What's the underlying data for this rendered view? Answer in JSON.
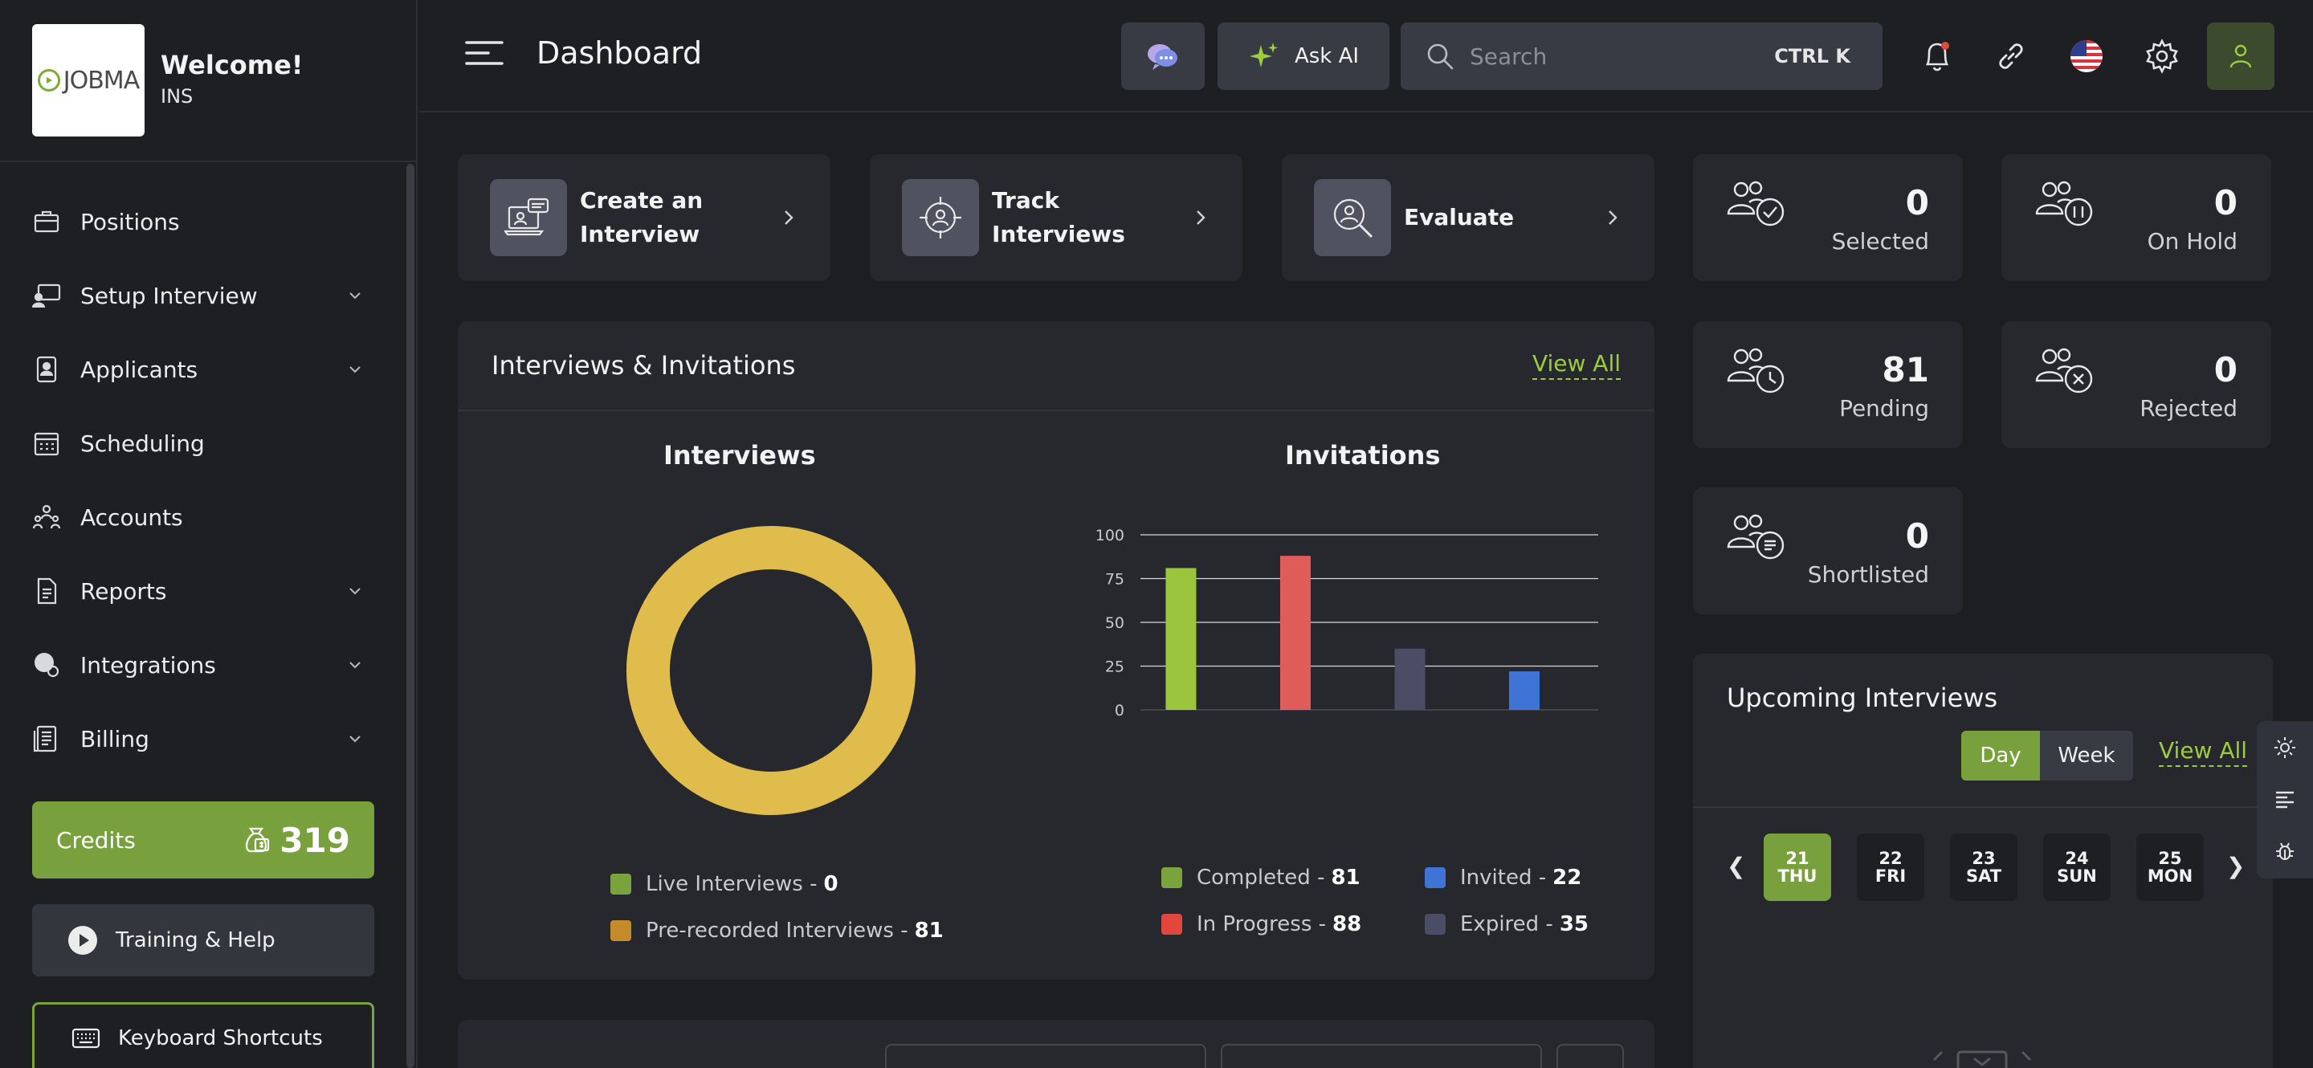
{
  "brand": {
    "logo_text": "JOBMA",
    "welcome": "Welcome!",
    "org": "INS"
  },
  "sidebar": {
    "items": [
      {
        "label": "Positions",
        "icon": "briefcase-icon",
        "expandable": false
      },
      {
        "label": "Setup Interview",
        "icon": "screen-user-icon",
        "expandable": true
      },
      {
        "label": "Applicants",
        "icon": "id-card-icon",
        "expandable": true
      },
      {
        "label": "Scheduling",
        "icon": "calendar-icon",
        "expandable": false
      },
      {
        "label": "Accounts",
        "icon": "team-icon",
        "expandable": false
      },
      {
        "label": "Reports",
        "icon": "document-icon",
        "expandable": true
      },
      {
        "label": "Integrations",
        "icon": "puzzle-icon",
        "expandable": true
      },
      {
        "label": "Billing",
        "icon": "receipt-icon",
        "expandable": true
      }
    ],
    "credits_label": "Credits",
    "credits_value": "319",
    "training_label": "Training & Help",
    "shortcuts_label": "Keyboard Shortcuts"
  },
  "topbar": {
    "title": "Dashboard",
    "ask_ai_label": "Ask AI",
    "search_placeholder": "Search",
    "search_shortcut": "CTRL K"
  },
  "quick_actions": [
    {
      "label": "Create an Interview",
      "icon": "laptop-chat-icon"
    },
    {
      "label": "Track Interviews",
      "icon": "target-user-icon"
    },
    {
      "label": "Evaluate",
      "icon": "magnify-user-icon"
    }
  ],
  "stats": [
    {
      "value": "0",
      "label": "Selected",
      "icon": "users-check-icon"
    },
    {
      "value": "0",
      "label": "On Hold",
      "icon": "users-pause-icon"
    },
    {
      "value": "81",
      "label": "Pending",
      "icon": "users-clock-icon"
    },
    {
      "value": "0",
      "label": "Rejected",
      "icon": "users-x-icon"
    },
    {
      "value": "0",
      "label": "Shortlisted",
      "icon": "users-list-icon"
    }
  ],
  "panel": {
    "title": "Interviews & Invitations",
    "view_all": "View All",
    "interviews_title": "Interviews",
    "invitations_title": "Invitations"
  },
  "interviews_legend": [
    {
      "label": "Live Interviews - ",
      "value": "0",
      "color": "#7aa33e"
    },
    {
      "label": "Pre-recorded Interviews - ",
      "value": "81",
      "color": "#c58a2a"
    }
  ],
  "invitations_legend": [
    {
      "label": "Completed - ",
      "value": "81",
      "color": "#7aa33e"
    },
    {
      "label": "Invited - ",
      "value": "22",
      "color": "#3f74d6"
    },
    {
      "label": "In Progress - ",
      "value": "88",
      "color": "#e2473c"
    },
    {
      "label": "Expired - ",
      "value": "35",
      "color": "#4a4d63"
    }
  ],
  "chart_data": [
    {
      "type": "pie",
      "title": "Interviews",
      "categories": [
        "Live Interviews",
        "Pre-recorded Interviews"
      ],
      "values": [
        0,
        81
      ],
      "colors": [
        "#7aa33e",
        "#e0bc4c"
      ]
    },
    {
      "type": "bar",
      "title": "Invitations",
      "categories": [
        "Completed",
        "In Progress",
        "Expired",
        "Invited"
      ],
      "values": [
        81,
        88,
        35,
        22
      ],
      "colors": [
        "#9bc53d",
        "#e05c59",
        "#4a4d63",
        "#3f74d6"
      ],
      "ylim": [
        0,
        100
      ],
      "yticks": [
        0,
        25,
        50,
        75,
        100
      ],
      "grid": true
    }
  ],
  "upcoming": {
    "title": "Upcoming Interviews",
    "day_label": "Day",
    "week_label": "Week",
    "view_all": "View All",
    "prev": "❮",
    "next": "❯",
    "days": [
      {
        "num": "21",
        "dow": "THU",
        "active": true
      },
      {
        "num": "22",
        "dow": "FRI",
        "active": false
      },
      {
        "num": "23",
        "dow": "SAT",
        "active": false
      },
      {
        "num": "24",
        "dow": "SUN",
        "active": false
      },
      {
        "num": "25",
        "dow": "MON",
        "active": false
      }
    ]
  },
  "colors": {
    "accent": "#78a03c",
    "accent_text": "#9ccc3f",
    "card": "#26282e",
    "background": "#1c1e22"
  }
}
